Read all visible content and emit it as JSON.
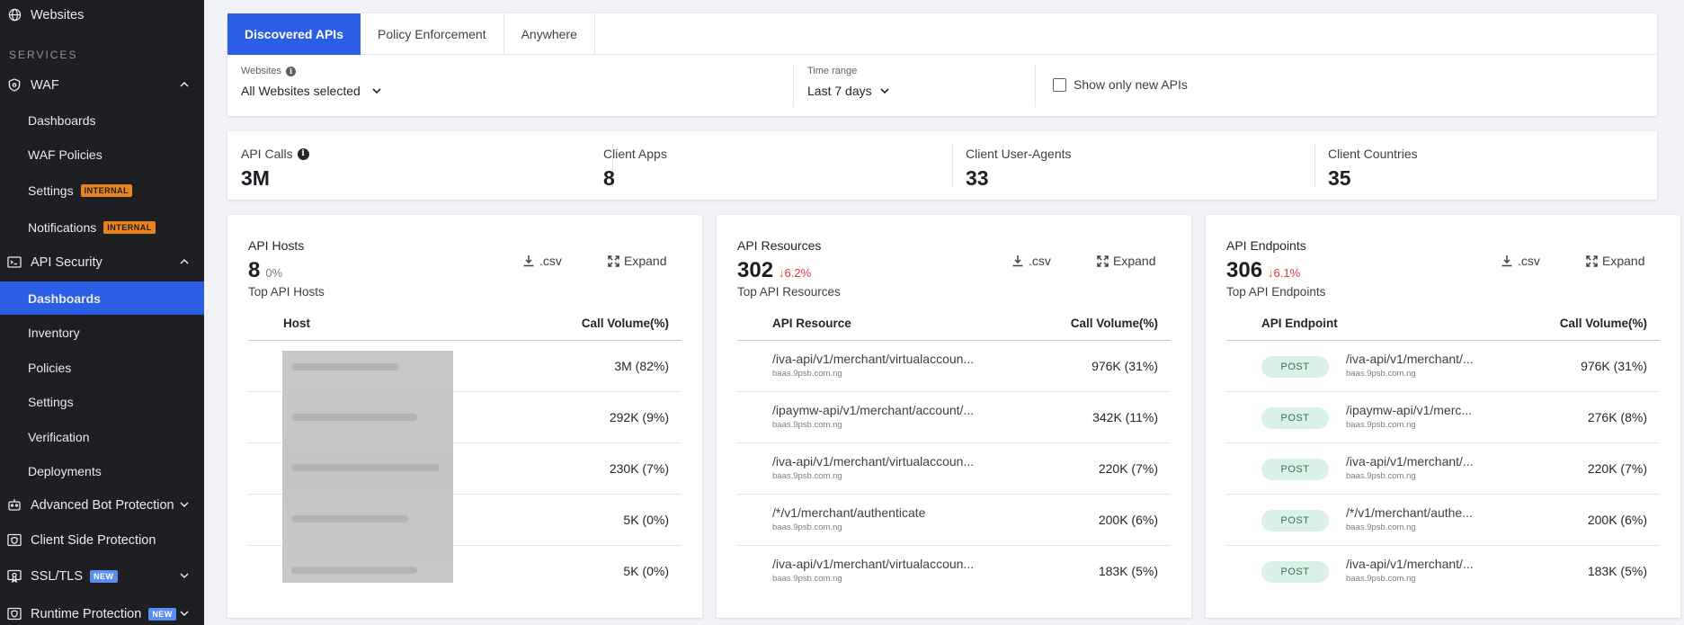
{
  "sidebar": {
    "websites": "Websites",
    "section": "SERVICES",
    "waf": "WAF",
    "waf_items": [
      "Dashboards",
      "WAF Policies",
      "Settings",
      "Notifications"
    ],
    "internal_tag": "INTERNAL",
    "api_security": "API Security",
    "api_items": [
      "Dashboards",
      "Inventory",
      "Policies",
      "Settings",
      "Verification",
      "Deployments"
    ],
    "bot": "Advanced Bot Protection",
    "client_side": "Client Side Protection",
    "ssl": "SSL/TLS",
    "runtime": "Runtime Protection",
    "new_tag": "NEW"
  },
  "tabs": [
    "Discovered APIs",
    "Policy Enforcement",
    "Anywhere"
  ],
  "filters": {
    "websites_label": "Websites",
    "websites_value": "All Websites selected",
    "time_label": "Time range",
    "time_value": "Last 7 days",
    "new_apis": "Show only new APIs"
  },
  "stats": [
    {
      "label": "API Calls",
      "value": "3M"
    },
    {
      "label": "Client Apps",
      "value": "8"
    },
    {
      "label": "Client User-Agents",
      "value": "33"
    },
    {
      "label": "Client Countries",
      "value": "35"
    }
  ],
  "actions": {
    "csv": ".csv",
    "expand": "Expand"
  },
  "hosts": {
    "title": "API Hosts",
    "count": "8",
    "delta": "0%",
    "subtitle": "Top API Hosts",
    "col1": "Host",
    "col2": "Call Volume(%)",
    "rows": [
      "3M (82%)",
      "292K (9%)",
      "230K (7%)",
      "5K (0%)",
      "5K (0%)"
    ]
  },
  "resources": {
    "title": "API Resources",
    "count": "302",
    "delta": "↓6.2%",
    "subtitle": "Top API Resources",
    "col1": "API Resource",
    "col2": "Call Volume(%)",
    "rows": [
      {
        "path": "/iva-api/v1/merchant/virtualaccoun...",
        "host": "baas.9psb.com.ng",
        "vol": "976K (31%)"
      },
      {
        "path": "/ipaymw-api/v1/merchant/account/...",
        "host": "baas.9psb.com.ng",
        "vol": "342K (11%)"
      },
      {
        "path": "/iva-api/v1/merchant/virtualaccoun...",
        "host": "baas.9psb.com.ng",
        "vol": "220K (7%)"
      },
      {
        "path": "/*/v1/merchant/authenticate",
        "host": "baas.9psb.com.ng",
        "vol": "200K (6%)"
      },
      {
        "path": "/iva-api/v1/merchant/virtualaccoun...",
        "host": "baas.9psb.com.ng",
        "vol": "183K (5%)"
      }
    ]
  },
  "endpoints": {
    "title": "API Endpoints",
    "count": "306",
    "delta": "↓6.1%",
    "subtitle": "Top API Endpoints",
    "col1": "API Endpoint",
    "col2": "Call Volume(%)",
    "rows": [
      {
        "method": "POST",
        "path": "/iva-api/v1/merchant/...",
        "host": "baas.9psb.com.ng",
        "vol": "976K (31%)"
      },
      {
        "method": "POST",
        "path": "/ipaymw-api/v1/merc...",
        "host": "baas.9psb.com.ng",
        "vol": "276K (8%)"
      },
      {
        "method": "POST",
        "path": "/iva-api/v1/merchant/...",
        "host": "baas.9psb.com.ng",
        "vol": "220K (7%)"
      },
      {
        "method": "POST",
        "path": "/*/v1/merchant/authe...",
        "host": "baas.9psb.com.ng",
        "vol": "200K (6%)"
      },
      {
        "method": "POST",
        "path": "/iva-api/v1/merchant/...",
        "host": "baas.9psb.com.ng",
        "vol": "183K (5%)"
      }
    ]
  }
}
